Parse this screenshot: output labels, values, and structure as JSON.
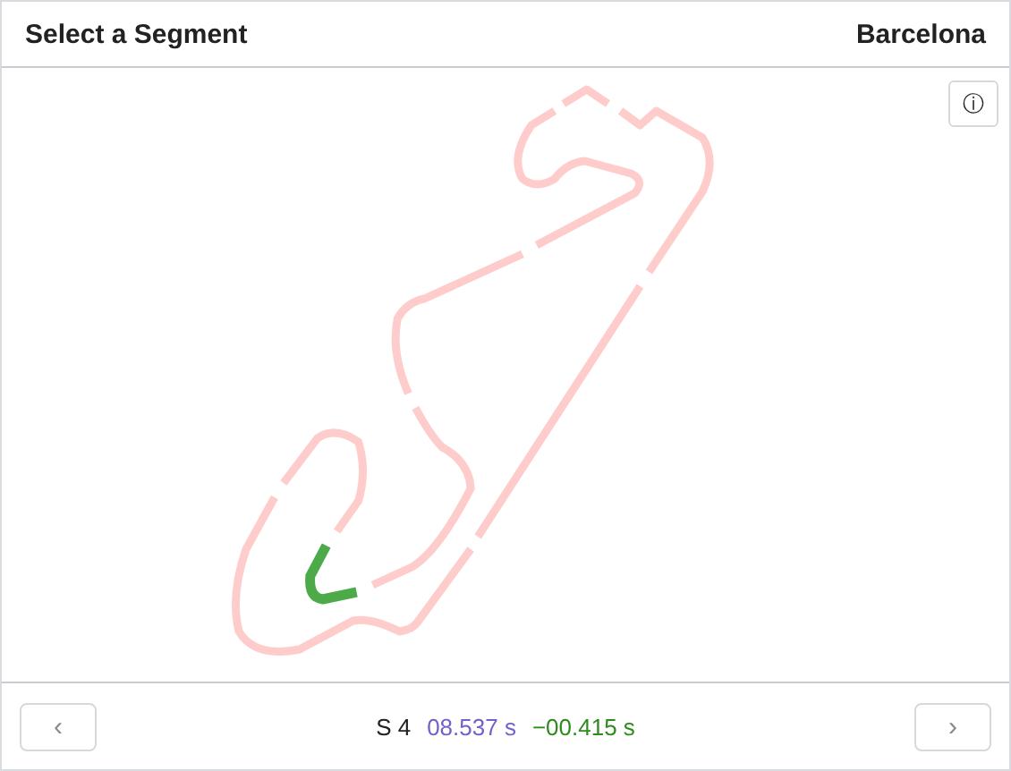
{
  "header": {
    "title": "Select a Segment",
    "track_name": "Barcelona"
  },
  "info_button": {
    "label": "ⓘ"
  },
  "segments": [
    {
      "selected": false
    },
    {
      "selected": false
    },
    {
      "selected": false
    },
    {
      "selected": true
    },
    {
      "selected": false
    },
    {
      "selected": false
    },
    {
      "selected": false
    },
    {
      "selected": false
    },
    {
      "selected": false
    }
  ],
  "footer": {
    "prev": "‹",
    "next": "›",
    "segment": "S 4",
    "time": "08.537 s",
    "delta": "−00.415 s"
  }
}
